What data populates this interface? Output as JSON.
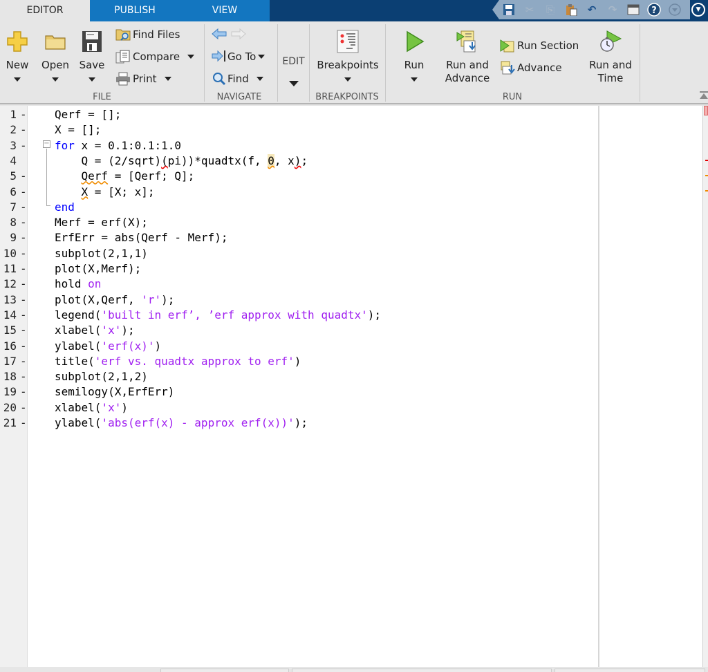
{
  "tabs": [
    {
      "label": "EDITOR",
      "active": true
    },
    {
      "label": "PUBLISH",
      "active": false
    },
    {
      "label": "VIEW",
      "active": false
    }
  ],
  "quick_access": [
    "save-icon",
    "cut-icon",
    "copy-icon",
    "paste-icon",
    "undo-icon",
    "redo-icon",
    "window-icon",
    "help-icon",
    "dropdown-icon"
  ],
  "ribbon": {
    "file": {
      "group_label": "FILE",
      "new_label": "New",
      "open_label": "Open",
      "save_label": "Save",
      "find_files_label": "Find Files",
      "compare_label": "Compare",
      "print_label": "Print"
    },
    "navigate": {
      "group_label": "NAVIGATE",
      "goto_label": "Go To",
      "find_label": "Find"
    },
    "edit": {
      "group_label": "EDIT"
    },
    "breakpoints": {
      "group_label": "BREAKPOINTS",
      "breakpoints_label": "Breakpoints"
    },
    "run": {
      "group_label": "RUN",
      "run_label": "Run",
      "run_advance_line1": "Run and",
      "run_advance_line2": "Advance",
      "run_section_label": "Run Section",
      "advance_label": "Advance",
      "run_time_line1": "Run and",
      "run_time_line2": "Time"
    }
  },
  "editor": {
    "lines": [
      {
        "n": "1",
        "dash": "-",
        "segments": [
          [
            "",
            "Qerf = [];"
          ]
        ]
      },
      {
        "n": "2",
        "dash": "-",
        "segments": [
          [
            "",
            "X = [];"
          ]
        ]
      },
      {
        "n": "3",
        "dash": "-",
        "segments": [
          [
            "kw",
            "for"
          ],
          [
            "",
            " x = 0.1:0.1:1.0"
          ]
        ]
      },
      {
        "n": "4",
        "dash": "",
        "segments": [
          [
            "",
            "    Q = (2/sqrt)"
          ],
          [
            "squig-red",
            "("
          ],
          [
            "",
            "pi))*quadtx(f, "
          ],
          [
            "hl squig",
            "0"
          ],
          [
            "",
            ", x"
          ],
          [
            "squig-red",
            ")"
          ],
          [
            "",
            ";"
          ]
        ]
      },
      {
        "n": "5",
        "dash": "-",
        "segments": [
          [
            "",
            "    "
          ],
          [
            "squig",
            "Qerf"
          ],
          [
            "",
            " = [Qerf; Q];"
          ]
        ]
      },
      {
        "n": "6",
        "dash": "-",
        "segments": [
          [
            "",
            "    "
          ],
          [
            "squig",
            "X"
          ],
          [
            "",
            " = [X; x];"
          ]
        ]
      },
      {
        "n": "7",
        "dash": "-",
        "segments": [
          [
            "kw",
            "end"
          ]
        ]
      },
      {
        "n": "8",
        "dash": "-",
        "segments": [
          [
            "",
            "Merf = erf(X);"
          ]
        ]
      },
      {
        "n": "9",
        "dash": "-",
        "segments": [
          [
            "",
            "ErfErr = abs(Qerf - Merf);"
          ]
        ]
      },
      {
        "n": "10",
        "dash": "-",
        "segments": [
          [
            "",
            "subplot(2,1,1)"
          ]
        ]
      },
      {
        "n": "11",
        "dash": "-",
        "segments": [
          [
            "",
            "plot(X,Merf);"
          ]
        ]
      },
      {
        "n": "12",
        "dash": "-",
        "segments": [
          [
            "",
            "hold "
          ],
          [
            "str",
            "on"
          ]
        ]
      },
      {
        "n": "13",
        "dash": "-",
        "segments": [
          [
            "",
            "plot(X,Qerf, "
          ],
          [
            "str",
            "'r'"
          ],
          [
            "",
            ");"
          ]
        ]
      },
      {
        "n": "14",
        "dash": "-",
        "segments": [
          [
            "",
            "legend("
          ],
          [
            "str",
            "'built in erf’, ’erf approx with quadtx'"
          ],
          [
            "",
            ");"
          ]
        ]
      },
      {
        "n": "15",
        "dash": "-",
        "segments": [
          [
            "",
            "xlabel("
          ],
          [
            "str",
            "'x'"
          ],
          [
            "",
            ");"
          ]
        ]
      },
      {
        "n": "16",
        "dash": "-",
        "segments": [
          [
            "",
            "ylabel("
          ],
          [
            "str",
            "'erf(x)'"
          ],
          [
            "",
            ")"
          ]
        ]
      },
      {
        "n": "17",
        "dash": "-",
        "segments": [
          [
            "",
            "title("
          ],
          [
            "str",
            "'erf vs. quadtx approx to erf'"
          ],
          [
            "",
            ")"
          ]
        ]
      },
      {
        "n": "18",
        "dash": "-",
        "segments": [
          [
            "",
            "subplot(2,1,2)"
          ]
        ]
      },
      {
        "n": "19",
        "dash": "-",
        "segments": [
          [
            "",
            "semilogy(X,ErfErr)"
          ]
        ]
      },
      {
        "n": "20",
        "dash": "-",
        "segments": [
          [
            "",
            "xlabel("
          ],
          [
            "str",
            "'x'"
          ],
          [
            "",
            ")"
          ]
        ]
      },
      {
        "n": "21",
        "dash": "-",
        "segments": [
          [
            "",
            "ylabel("
          ],
          [
            "str",
            "'abs(erf(x) - approx erf(x))'"
          ],
          [
            "",
            ");"
          ]
        ]
      }
    ],
    "markers": [
      {
        "color": "#e00000",
        "line": 4
      },
      {
        "color": "#f08c00",
        "line": 5
      },
      {
        "color": "#f08c00",
        "line": 6
      }
    ]
  },
  "colors": {
    "tab_bar": "#0b3f73",
    "tab_inactive": "#1376c0",
    "keyword": "#0000ff",
    "string": "#a020f0",
    "warning": "#f08c00",
    "error": "#e00000"
  }
}
